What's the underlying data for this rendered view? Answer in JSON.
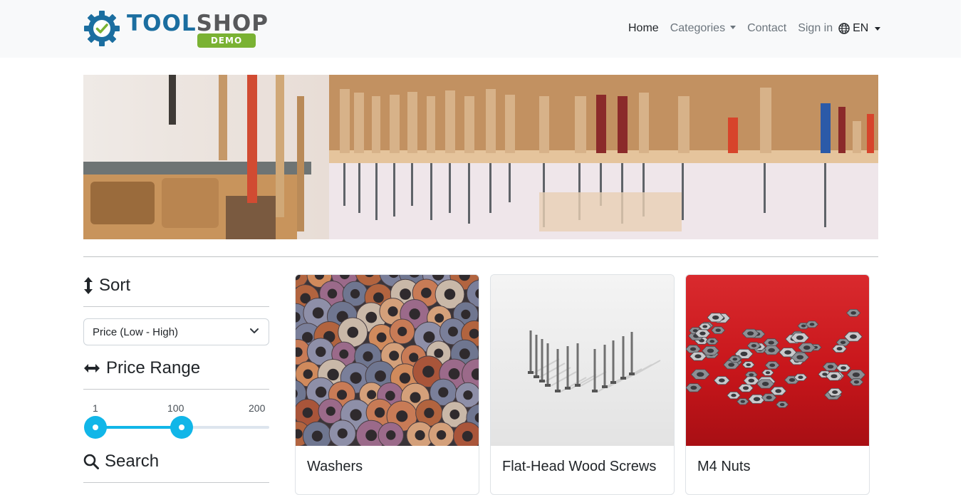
{
  "brand": {
    "name_part1": "TOOL",
    "name_part2": "SHOP",
    "badge": "DEMO"
  },
  "nav": {
    "home": "Home",
    "categories": "Categories",
    "contact": "Contact",
    "sign_in": "Sign in",
    "language": "EN"
  },
  "banner": {
    "icon": "tools-wall-photo"
  },
  "filters": {
    "sort": {
      "heading": "Sort",
      "selected": "Price (Low - High)"
    },
    "price_range": {
      "heading": "Price Range",
      "min_label": "1",
      "value_label": "100",
      "max_label": "200",
      "min": 1,
      "max": 200,
      "low": 1,
      "high": 100
    },
    "search": {
      "heading": "Search"
    }
  },
  "products": [
    {
      "name": "Washers",
      "image": "washers-photo"
    },
    {
      "name": "Flat-Head Wood Screws",
      "image": "screws-photo"
    },
    {
      "name": "M4 Nuts",
      "image": "nuts-photo"
    }
  ],
  "colors": {
    "brand_blue": "#1b6ea0",
    "brand_green": "#7ab233",
    "slider_accent": "#11b6e8"
  }
}
